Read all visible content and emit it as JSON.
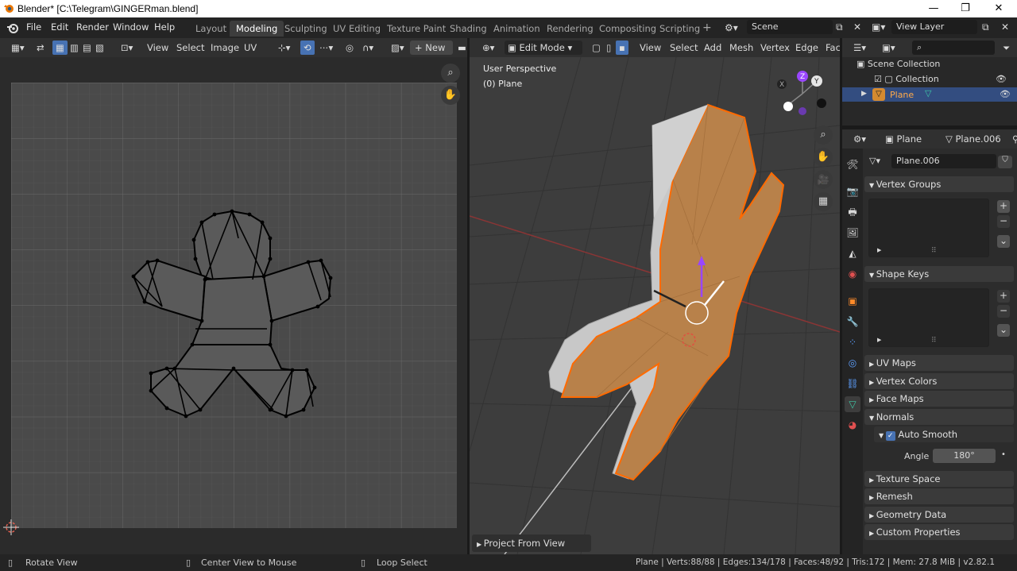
{
  "window": {
    "title": "Blender* [C:\\Telegram\\GINGERman.blend]",
    "minimize": "—",
    "maximize": "❐",
    "close": "✕"
  },
  "menubar": {
    "file": "File",
    "edit": "Edit",
    "render": "Render",
    "window": "Window",
    "help": "Help",
    "workspaces": [
      "Layout",
      "Modeling",
      "Sculpting",
      "UV Editing",
      "Texture Paint",
      "Shading",
      "Animation",
      "Rendering",
      "Compositing",
      "Scripting"
    ],
    "active_workspace": "Modeling",
    "add_workspace": "+",
    "scene": "Scene",
    "view_layer": "View Layer"
  },
  "uv_editor": {
    "view": "View",
    "select": "Select",
    "image": "Image",
    "uv": "UV",
    "new": "New"
  },
  "viewport": {
    "mode": "Edit Mode",
    "view": "View",
    "select": "Select",
    "add": "Add",
    "mesh": "Mesh",
    "vertex": "Vertex",
    "edge": "Edge",
    "face_trunc": "Fac",
    "perspective": "User Perspective",
    "object_label": "(0) Plane",
    "operator_panel": "Project From View",
    "gizmo_x": "X",
    "gizmo_y": "Y",
    "gizmo_z": "Z"
  },
  "outliner": {
    "scene_collection": "Scene Collection",
    "collection": "Collection",
    "plane": "Plane"
  },
  "properties": {
    "object_name": "Plane",
    "mesh_name": "Plane.006",
    "data_field": "Plane.006",
    "panels": {
      "vertex_groups": "Vertex Groups",
      "shape_keys": "Shape Keys",
      "uv_maps": "UV Maps",
      "vertex_colors": "Vertex Colors",
      "face_maps": "Face Maps",
      "normals": "Normals",
      "auto_smooth": "Auto Smooth",
      "angle_label": "Angle",
      "angle_value": "180°",
      "texture_space": "Texture Space",
      "remesh": "Remesh",
      "geometry_data": "Geometry Data",
      "custom_properties": "Custom Properties"
    }
  },
  "statusbar": {
    "rotate_view": "Rotate View",
    "center_view": "Center View to Mouse",
    "loop_select": "Loop Select",
    "stats": "Plane | Verts:88/88 | Edges:134/178 | Faces:48/92 | Tris:172 | Mem: 27.8 MiB | v2.82.1"
  },
  "colors": {
    "accent_blue": "#4772b3",
    "selection_orange": "#ff8a29",
    "mesh_fill": "#b87a45",
    "object_selected_row": "#334d80"
  }
}
